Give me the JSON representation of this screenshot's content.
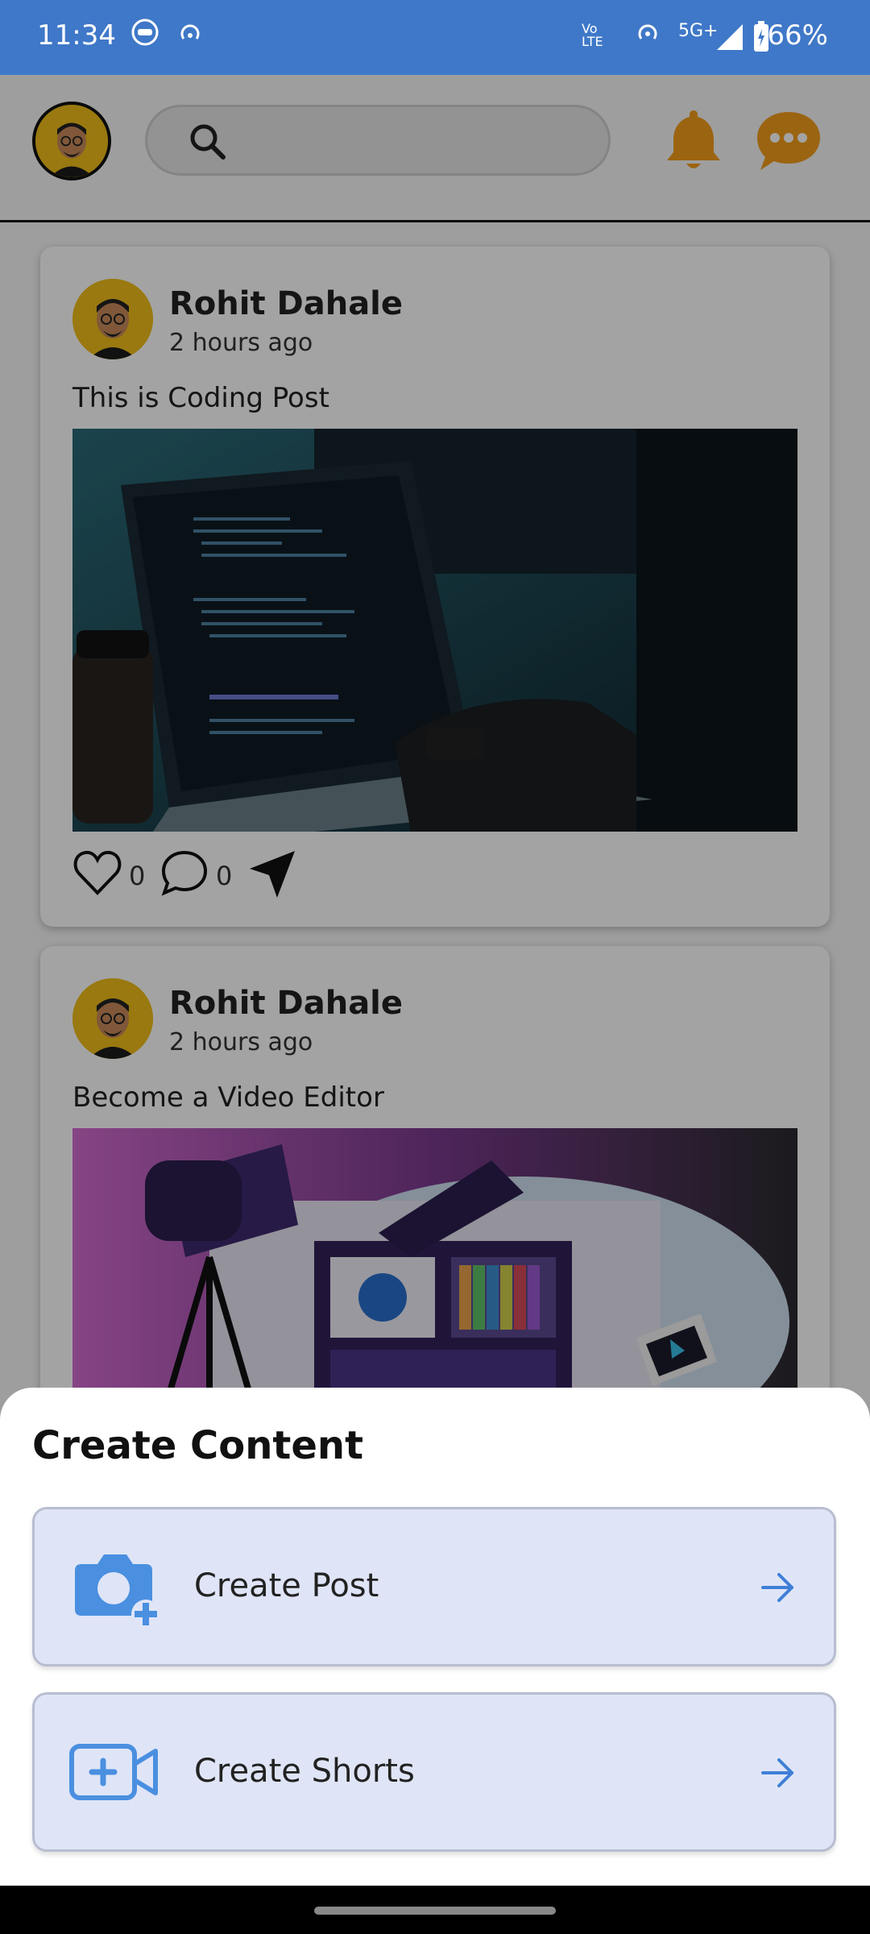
{
  "status_bar": {
    "time": "11:34",
    "network": "5G+",
    "volte": "Vo LTE",
    "battery": "66%"
  },
  "header": {
    "search_placeholder": ""
  },
  "posts": [
    {
      "author": "Rohit Dahale",
      "time": "2 hours ago",
      "text": "This is Coding Post",
      "likes": "0",
      "comments": "0"
    },
    {
      "author": "Rohit Dahale",
      "time": "2 hours ago",
      "text": "Become a Video Editor"
    }
  ],
  "sheet": {
    "title": "Create Content",
    "options": [
      {
        "label": "Create Post",
        "icon": "camera-plus-icon"
      },
      {
        "label": "Create Shorts",
        "icon": "video-plus-icon"
      }
    ]
  },
  "colors": {
    "accent": "#3f78c8",
    "icon_orange": "#f29d1c",
    "option_bg": "#dfe5f7"
  }
}
